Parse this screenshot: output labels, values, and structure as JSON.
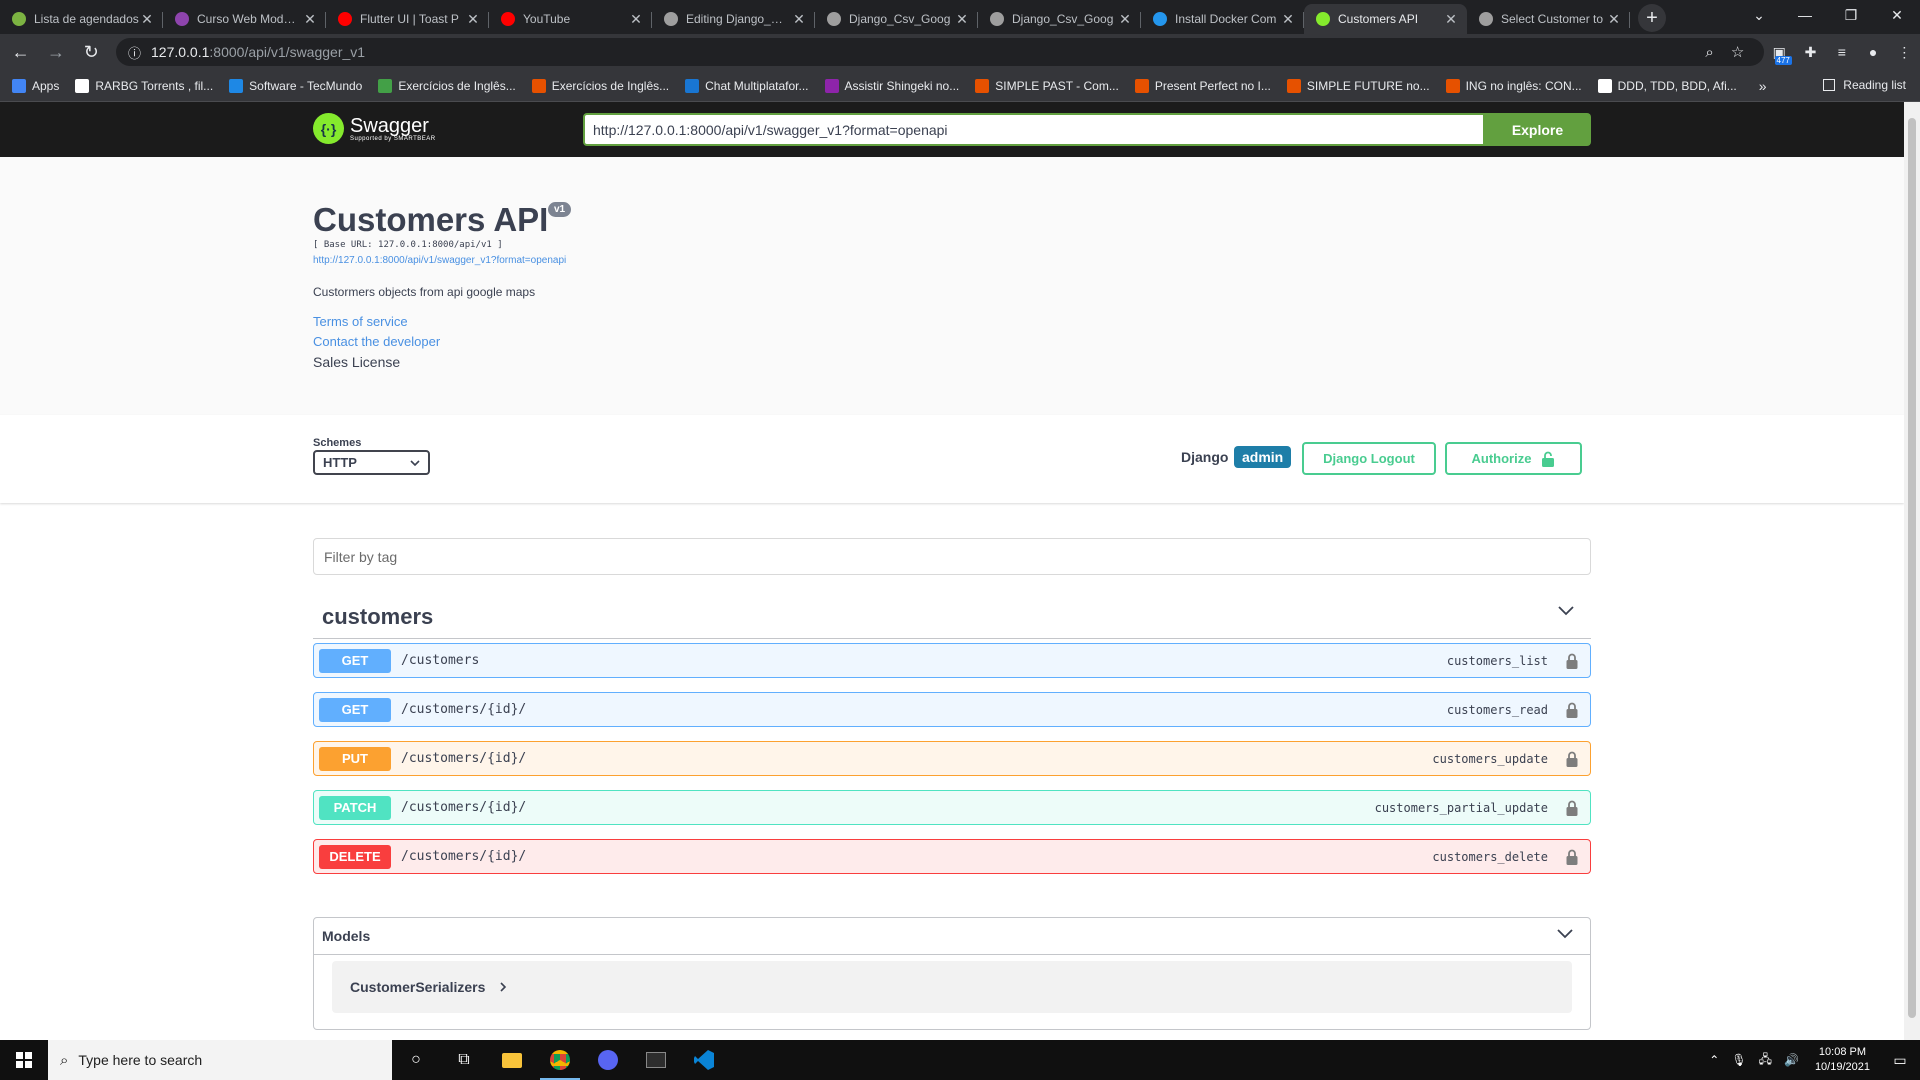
{
  "browser": {
    "tabs": [
      {
        "title": "Lista de agendados",
        "color": "#7cb342"
      },
      {
        "title": "Curso Web Moderno",
        "color": "#8e44ad"
      },
      {
        "title": "Flutter UI | Toast P",
        "color": "#ff0000"
      },
      {
        "title": "YouTube",
        "color": "#ff0000"
      },
      {
        "title": "Editing Django_Csv",
        "color": "#9e9e9e"
      },
      {
        "title": "Django_Csv_Goog",
        "color": "#9e9e9e"
      },
      {
        "title": "Django_Csv_Goog",
        "color": "#9e9e9e"
      },
      {
        "title": "Install Docker Com",
        "color": "#2496ed"
      },
      {
        "title": "Customers API",
        "color": "#85ea2d",
        "active": true
      },
      {
        "title": "Select Customer to",
        "color": "#9e9e9e"
      }
    ],
    "url_host": "127.0.0.1",
    "url_rest": ":8000/api/v1/swagger_v1",
    "extension_badge": "477",
    "bookmarks": [
      {
        "label": "Apps",
        "color": "#4285f4"
      },
      {
        "label": "RARBG Torrents , fil...",
        "color": "#ffffff"
      },
      {
        "label": "Software - TecMundo",
        "color": "#1e88e5"
      },
      {
        "label": "Exercícios de Inglês...",
        "color": "#43a047"
      },
      {
        "label": "Exercícios de Inglês...",
        "color": "#e65100"
      },
      {
        "label": "Chat Multiplatafor...",
        "color": "#1976d2"
      },
      {
        "label": "Assistir Shingeki no...",
        "color": "#8e24aa"
      },
      {
        "label": "SIMPLE PAST - Com...",
        "color": "#e65100"
      },
      {
        "label": "Present Perfect no I...",
        "color": "#e65100"
      },
      {
        "label": "SIMPLE FUTURE no...",
        "color": "#e65100"
      },
      {
        "label": "ING no inglês: CON...",
        "color": "#e65100"
      },
      {
        "label": "DDD, TDD, BDD, Afi...",
        "color": "#ffffff"
      }
    ],
    "bookmarks_more": "»",
    "reading_list": "Reading list"
  },
  "swagger": {
    "logo_name": "Swagger",
    "logo_sub": "Supported by SMARTBEAR",
    "spec_url_input": "http://127.0.0.1:8000/api/v1/swagger_v1?format=openapi",
    "explore_label": "Explore",
    "title": "Customers API",
    "version": "v1",
    "base_url": "[ Base URL: 127.0.0.1:8000/api/v1 ]",
    "spec_link": "http://127.0.0.1:8000/api/v1/swagger_v1?format=openapi",
    "description": "Custormers objects from api google maps",
    "terms": "Terms of service",
    "contact": "Contact the developer",
    "license": "Sales License",
    "schemes_label": "Schemes",
    "scheme_selected": "HTTP",
    "django_label": "Django",
    "django_user": "admin",
    "logout_label": "Django Logout",
    "authorize_label": "Authorize",
    "filter_placeholder": "Filter by tag",
    "tag_name": "customers",
    "operations": [
      {
        "method": "GET",
        "path": "/customers",
        "id": "customers_list"
      },
      {
        "method": "GET",
        "path": "/customers/{id}/",
        "id": "customers_read"
      },
      {
        "method": "PUT",
        "path": "/customers/{id}/",
        "id": "customers_update"
      },
      {
        "method": "PATCH",
        "path": "/customers/{id}/",
        "id": "customers_partial_update"
      },
      {
        "method": "DELETE",
        "path": "/customers/{id}/",
        "id": "customers_delete"
      }
    ],
    "models_label": "Models",
    "model_name": "CustomerSerializers"
  },
  "taskbar": {
    "search_placeholder": "Type here to search",
    "time": "10:08 PM",
    "date": "10/19/2021"
  }
}
